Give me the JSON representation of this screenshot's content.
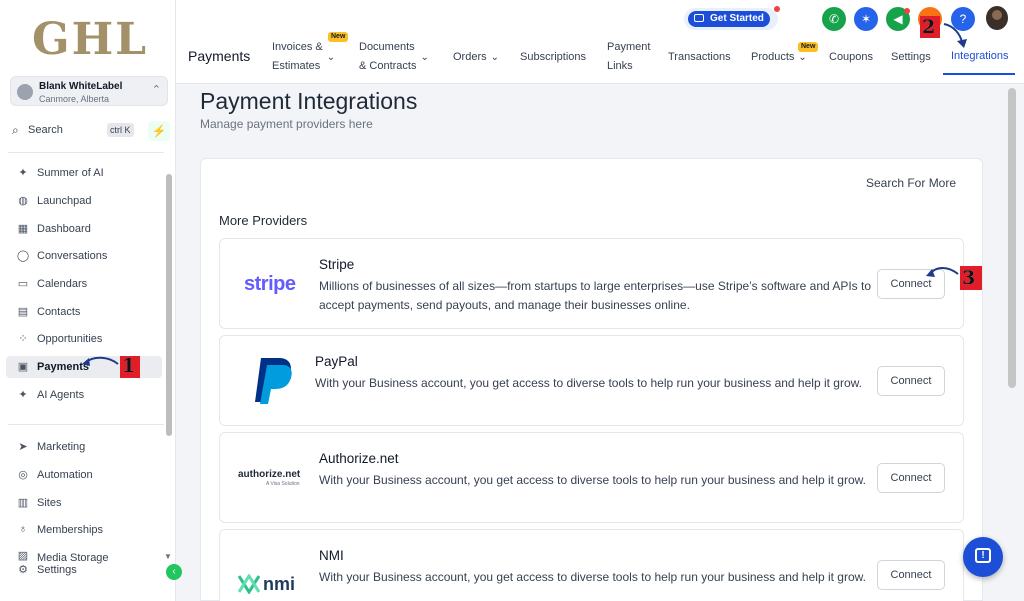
{
  "brand": {
    "logo_text": "GHL"
  },
  "account": {
    "name": "Blank WhiteLabel",
    "location": "Canmore, Alberta"
  },
  "search": {
    "label": "Search",
    "shortcut": "ctrl K"
  },
  "sidebar": {
    "items": [
      {
        "label": "Summer of AI",
        "icon": "sparkle-icon"
      },
      {
        "label": "Launchpad",
        "icon": "rocket-icon"
      },
      {
        "label": "Dashboard",
        "icon": "grid-icon"
      },
      {
        "label": "Conversations",
        "icon": "chat-icon"
      },
      {
        "label": "Calendars",
        "icon": "calendar-icon"
      },
      {
        "label": "Contacts",
        "icon": "contacts-icon"
      },
      {
        "label": "Opportunities",
        "icon": "opportunities-icon"
      },
      {
        "label": "Payments",
        "icon": "payments-icon",
        "active": true
      },
      {
        "label": "AI Agents",
        "icon": "sparkle-icon"
      },
      {
        "label": "Marketing",
        "icon": "send-icon"
      },
      {
        "label": "Automation",
        "icon": "automation-icon"
      },
      {
        "label": "Sites",
        "icon": "sites-icon"
      },
      {
        "label": "Memberships",
        "icon": "membership-icon"
      },
      {
        "label": "Media Storage",
        "icon": "media-icon"
      },
      {
        "label": "Settings",
        "icon": "gear-icon"
      }
    ]
  },
  "topbar": {
    "get_started": "Get Started",
    "section_title": "Payments",
    "tabs": [
      {
        "label": "Invoices &\nEstimates",
        "badge": "New",
        "dropdown": true
      },
      {
        "label": "Documents\n& Contracts",
        "dropdown": true
      },
      {
        "label": "Orders",
        "dropdown": true
      },
      {
        "label": "Subscriptions"
      },
      {
        "label": "Payment\nLinks"
      },
      {
        "label": "Transactions"
      },
      {
        "label": "Products",
        "badge": "New",
        "dropdown": true
      },
      {
        "label": "Coupons"
      },
      {
        "label": "Settings"
      },
      {
        "label": "Integrations",
        "active": true
      }
    ]
  },
  "page": {
    "title": "Payment Integrations",
    "subtitle": "Manage payment providers here",
    "search_more": "Search For More",
    "more_providers": "More Providers"
  },
  "providers": [
    {
      "name": "Stripe",
      "logo": "stripe",
      "description": "Millions of businesses of all sizes—from startups to large enterprises—use Stripe’s software and APIs to accept payments, send payouts, and manage their businesses online.",
      "action": "Connect"
    },
    {
      "name": "PayPal",
      "logo": "paypal-icon",
      "description": "With your Business account, you get access to diverse tools to help run your business and help it grow.",
      "action": "Connect"
    },
    {
      "name": "Authorize.net",
      "logo": "authorize.net",
      "logo_sub": "A Visa Solution",
      "description": "With your Business account, you get access to diverse tools to help run your business and help it grow.",
      "action": "Connect"
    },
    {
      "name": "NMI",
      "logo": "nmi",
      "description": "With your Business account, you get access to diverse tools to help run your business and help it grow.",
      "action": "Connect"
    }
  ],
  "annotations": [
    "1",
    "2",
    "3"
  ],
  "colors": {
    "accent": "#1d4ed8",
    "brand_gold": "#a3916a",
    "annotation_red": "#e11d2a",
    "stripe": "#635bff"
  }
}
